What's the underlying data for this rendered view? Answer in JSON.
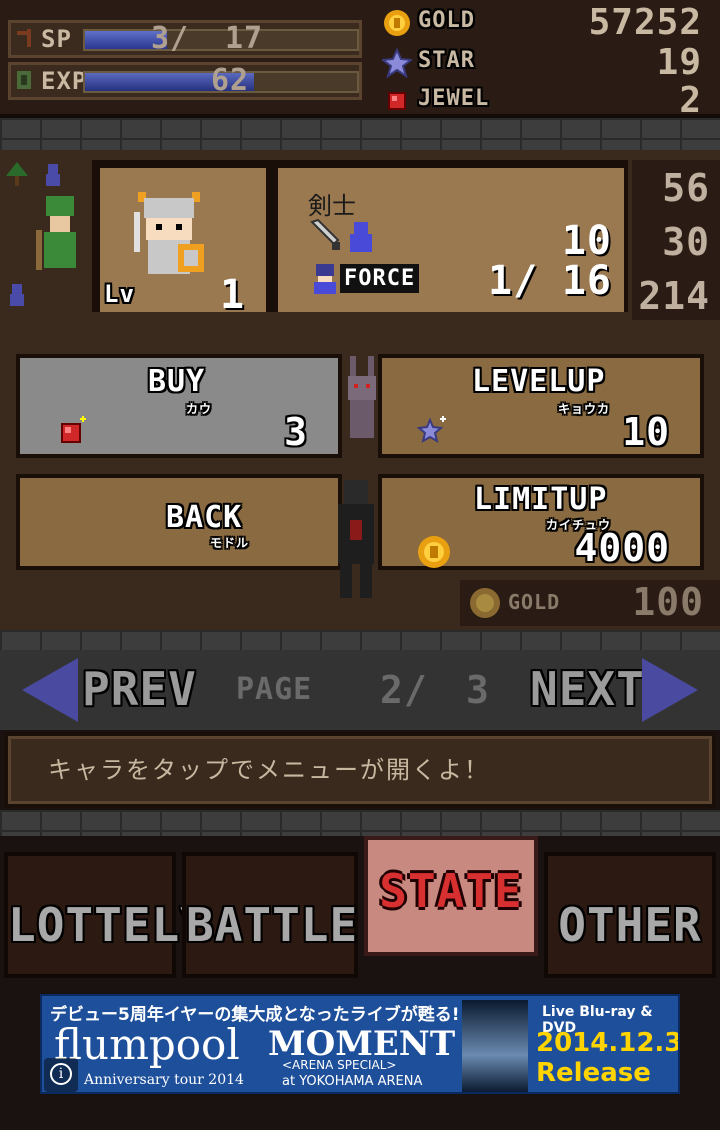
{
  "status": {
    "sp": {
      "label": "SP",
      "current": "3/",
      "max": "17",
      "fill_fraction": 0.18
    },
    "exp": {
      "label": "EXP",
      "value": "62",
      "fill_fraction": 0.62
    }
  },
  "resources": [
    {
      "icon": "gold-coin-icon",
      "label": "GOLD",
      "value": "57252"
    },
    {
      "icon": "star-icon",
      "label": "STAR",
      "value": "19"
    },
    {
      "icon": "jewel-icon",
      "label": "JEWEL",
      "value": "2"
    }
  ],
  "character": {
    "name": "剣士",
    "level_label": "Lv",
    "level": "1",
    "attack": "10",
    "force_label": "FORCE",
    "force_current": "1/",
    "force_max": "16",
    "side_stats": [
      "56",
      "30",
      "214"
    ]
  },
  "actions": {
    "buy": {
      "title": "BUY",
      "subtitle": "カウ",
      "cost": "3",
      "cost_icon": "jewel-icon"
    },
    "levelup": {
      "title": "LEVELUP",
      "subtitle": "キョウカ",
      "cost": "10",
      "cost_icon": "star-icon"
    },
    "back": {
      "title": "BACK",
      "subtitle": "モドル"
    },
    "limitup": {
      "title": "LIMITUP",
      "subtitle": "カイチュウ",
      "cost": "4000",
      "cost_icon": "gold-coin-icon"
    },
    "gold_row": {
      "label": "GOLD",
      "value": "100"
    }
  },
  "navigation": {
    "prev_label": "PREV",
    "page_label": "PAGE",
    "page_current": "2/",
    "page_total": "3",
    "next_label": "NEXT"
  },
  "message": "キャラをタップでメニューが開くよ！",
  "tabs": [
    {
      "label": "LOTTELY",
      "active": false
    },
    {
      "label": "BATTLE",
      "active": false
    },
    {
      "label": "STATE",
      "active": true
    },
    {
      "label": "OTHER",
      "active": false
    }
  ],
  "ad": {
    "headline": "デビュー5周年イヤーの集大成となったライブが甦る!",
    "brand": "flumpool",
    "tour": "Anniversary tour 2014",
    "title": "MOMENT",
    "arena": "<ARENA SPECIAL>",
    "venue": "at YOKOHAMA ARENA",
    "format": "Live Blu-ray & DVD",
    "date": "2014.12.3",
    "release": "Release"
  },
  "colors": {
    "panel_brown": "#8a6a40",
    "panel_gray": "#8a8a8a",
    "active_tab_bg": "#c88a80",
    "active_tab_text": "#d83030",
    "bar_blue": "#3a48a8",
    "ad_blue": "#1e4f9a",
    "ad_yellow": "#ffd400"
  }
}
